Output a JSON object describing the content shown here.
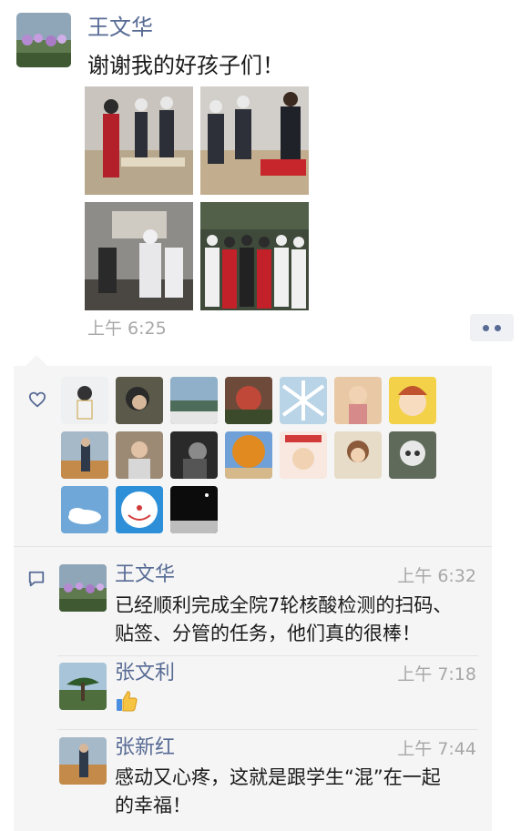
{
  "post": {
    "author": "王文华",
    "text": "谢谢我的好孩子们！",
    "time": "上午 6:25",
    "photos": [
      "photo-1",
      "photo-2",
      "photo-3",
      "photo-4"
    ]
  },
  "likes": {
    "icon": "heart-icon",
    "count_shown": 17
  },
  "comments": [
    {
      "author": "王文华",
      "time": "上午 6:32",
      "text_line1": "已经顺利完成全院7轮核酸检测的扫码、",
      "text_line2": "贴签、分管的任务，他们真的很棒！"
    },
    {
      "author": "张文利",
      "time": "上午 7:18",
      "emoji": "thumbs-up-icon"
    },
    {
      "author": "张新红",
      "time": "上午 7:44",
      "text_line1": "感动又心疼，这就是跟学生“混”在一起",
      "text_line2": "的幸福！"
    }
  ],
  "colors": {
    "name_link": "#576b95",
    "time_gray": "#a7a7a7",
    "panel_bg": "#f5f5f5"
  }
}
